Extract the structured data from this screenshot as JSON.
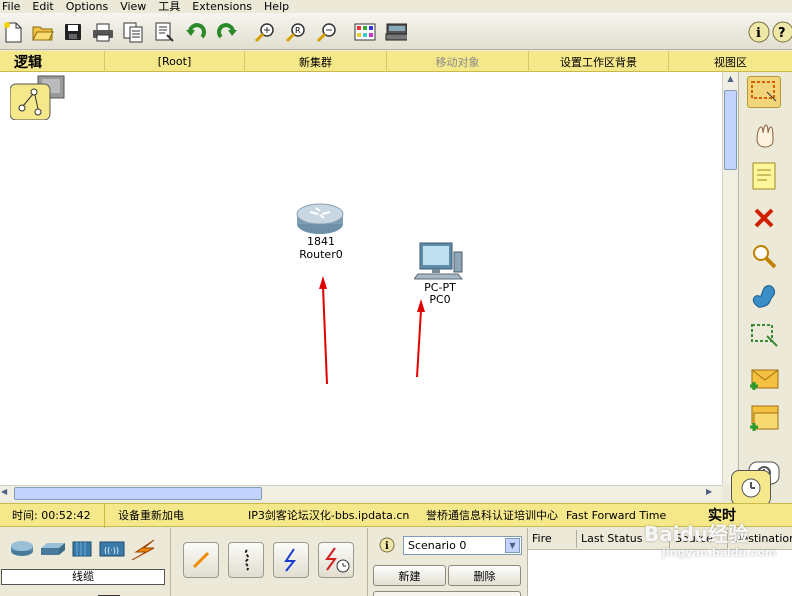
{
  "menu": {
    "items": [
      "File",
      "Edit",
      "Options",
      "View",
      "工具",
      "Extensions",
      "Help"
    ]
  },
  "toolbar": {
    "icons": [
      "new-file-icon",
      "open-folder-icon",
      "save-icon",
      "print-icon",
      "copy-icon",
      "activity-wizard-icon",
      "undo-icon",
      "redo-icon",
      "zoom-in-icon",
      "zoom-reset-icon",
      "zoom-out-icon",
      "palette-icon",
      "custom-device-icon",
      "info-icon",
      "help-icon"
    ]
  },
  "logic_bar": {
    "mode_label": "逻辑",
    "root": "[Root]",
    "new_cluster": "新集群",
    "move_object": "移动对象",
    "set_background": "设置工作区背景",
    "viewport": "视图区"
  },
  "devices": [
    {
      "model": "1841",
      "name": "Router0",
      "type": "router"
    },
    {
      "model": "PC-PT",
      "name": "PC0",
      "type": "pc"
    }
  ],
  "colors": {
    "accent_yellow": "#f5e88a",
    "arrow_red": "#e00000",
    "link_blue": "#1f5fd0"
  },
  "status_bar": {
    "time_label": "时间: 00:52:42",
    "power_cycle": "设备重新加电",
    "credit": "IP3剑客论坛汉化-bbs.ipdata.cn",
    "credit2": "誉桥通信息科认证培训中心",
    "fast_forward": "Fast Forward Time",
    "realtime_label": "实时"
  },
  "bottom_panel": {
    "category_label": "线缆",
    "scenario": {
      "selected": "Scenario 0"
    },
    "new_button": "新建",
    "delete_button": "删除",
    "pdu_columns": [
      "Fire",
      "Last Status",
      "Source",
      "Destination"
    ]
  },
  "watermark": {
    "brand": "Baidu经验",
    "url": "jingyan.baidu.com"
  }
}
